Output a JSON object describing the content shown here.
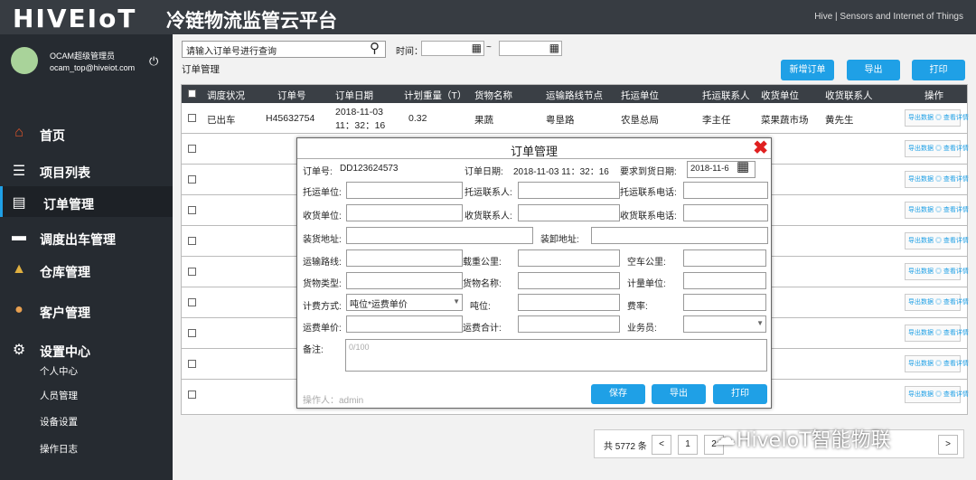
{
  "header": {
    "logo": "HIVEIoT",
    "title": "冷链物流监管云平台",
    "tagline": "Hive | Sensors and Internet of Things"
  },
  "user": {
    "name": "OCAM超级管理员",
    "email": "ocam_top@hiveiot.com"
  },
  "nav": {
    "items": [
      {
        "label": "首页",
        "icon": "home-icon"
      },
      {
        "label": "项目列表",
        "icon": "list-icon"
      },
      {
        "label": "订单管理",
        "icon": "order-icon",
        "active": true
      },
      {
        "label": "调度出车管理",
        "icon": "truck-icon"
      },
      {
        "label": "仓库管理",
        "icon": "warehouse-icon"
      },
      {
        "label": "客户管理",
        "icon": "customers-icon"
      },
      {
        "label": "设置中心",
        "icon": "gear-icon"
      }
    ],
    "settings_sub": [
      "个人中心",
      "人员管理",
      "设备设置",
      "操作日志"
    ]
  },
  "toolbar": {
    "search_placeholder": "请输入订单号进行查询",
    "time_label": "时间：",
    "tilde": "~",
    "breadcrumb": "订单管理",
    "new_order": "新增订单",
    "export": "导出",
    "print": "打印"
  },
  "table": {
    "headers": [
      "调度状况",
      "订单号",
      "订单日期",
      "计划重量（T）",
      "货物名称",
      "运输路线节点",
      "托运单位",
      "托运联系人",
      "收货单位",
      "收货联系人",
      "操作"
    ],
    "first_row": {
      "status": "已出车",
      "order_no": "H45632754",
      "date_line1": "2018-11-03",
      "date_line2": "11：32：16",
      "weight": "0.32",
      "goods": "果蔬",
      "route": "粤垦路",
      "shipper": "农垦总局",
      "shipper_contact": "李主任",
      "receiver": "菜果蔬市场",
      "receiver_contact": "黄先生"
    },
    "action_text": "导出数据 ◎ 查看详情",
    "empty_rows": 9
  },
  "pager": {
    "total": "共 5772 条",
    "prev": "<",
    "page1": "1",
    "page2": "2",
    "next": ">"
  },
  "watermark": "HiveIoT智能物联",
  "modal": {
    "title": "订单管理",
    "order_no_label": "订单号:",
    "order_no": "DD123624573",
    "order_date_label": "订单日期:",
    "order_date": "2018-11-03 11：32：16",
    "arrival_label": "要求到货日期:",
    "arrival_date": "2018-11-6",
    "shipper_label": "托运单位:",
    "shipper_contact_label": "托运联系人:",
    "shipper_phone_label": "托运联系电话:",
    "receiver_label": "收货单位:",
    "receiver_contact_label": "收货联系人:",
    "receiver_phone_label": "收货联系电话:",
    "load_addr_label": "装货地址:",
    "unload_addr_label": "装卸地址:",
    "route_label": "运输路线:",
    "loaded_km_label": "载重公里:",
    "empty_km_label": "空车公里:",
    "goods_type_label": "货物类型:",
    "goods_name_label": "货物名称:",
    "unit_label": "计量单位:",
    "billing_label": "计费方式:",
    "billing_value": "吨位*运费单价",
    "tonnage_label": "吨位:",
    "rate_label": "费率:",
    "unit_price_label": "运费单价:",
    "total_label": "运费合计:",
    "salesman_label": "业务员:",
    "remark_label": "备注:",
    "remark_counter": "0/100",
    "operator": "操作人：admin",
    "save": "保存",
    "export": "导出",
    "print": "打印"
  }
}
